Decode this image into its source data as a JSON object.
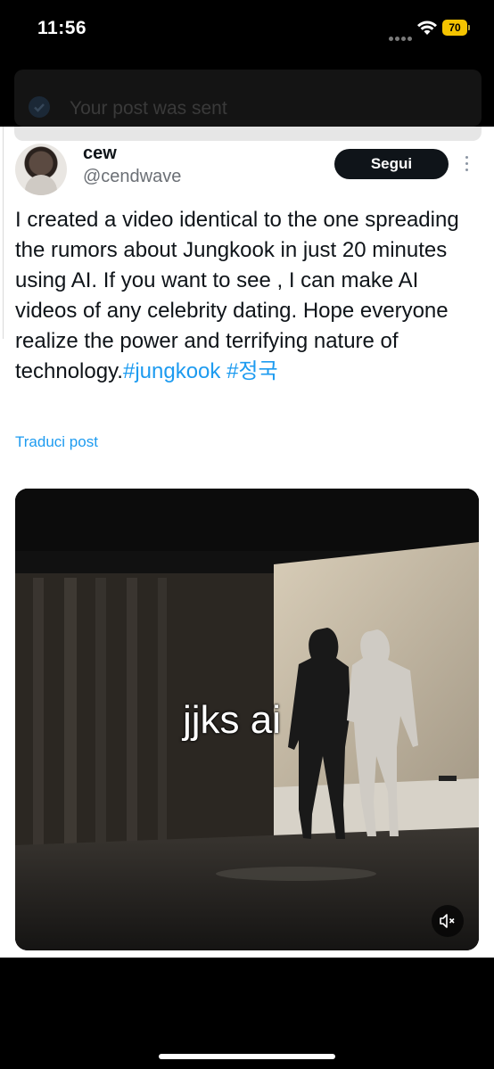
{
  "status_bar": {
    "time": "11:56",
    "battery": "70"
  },
  "toast": {
    "message": "Your post was sent"
  },
  "post": {
    "display_name": "cew",
    "handle": "@cendwave",
    "follow_label": "Segui",
    "text": "I created a video identical to the one spreading the rumors about Jungkook in just 20 minutes using AI. If you want to see , I can make AI videos of any celebrity dating. Hope everyone realize the power and terrifying nature of technology.",
    "hashtags": [
      "#jungkook",
      "#정국"
    ],
    "translate_label": "Traduci post"
  },
  "media": {
    "caption": "jjks ai"
  },
  "colors": {
    "accent": "#1d9bf0",
    "follow_bg": "#0f1419",
    "battery": "#f5c400"
  },
  "icons": [
    "signal-icon",
    "wifi-icon",
    "battery-icon",
    "check-icon",
    "more-options-icon",
    "mute-icon"
  ]
}
